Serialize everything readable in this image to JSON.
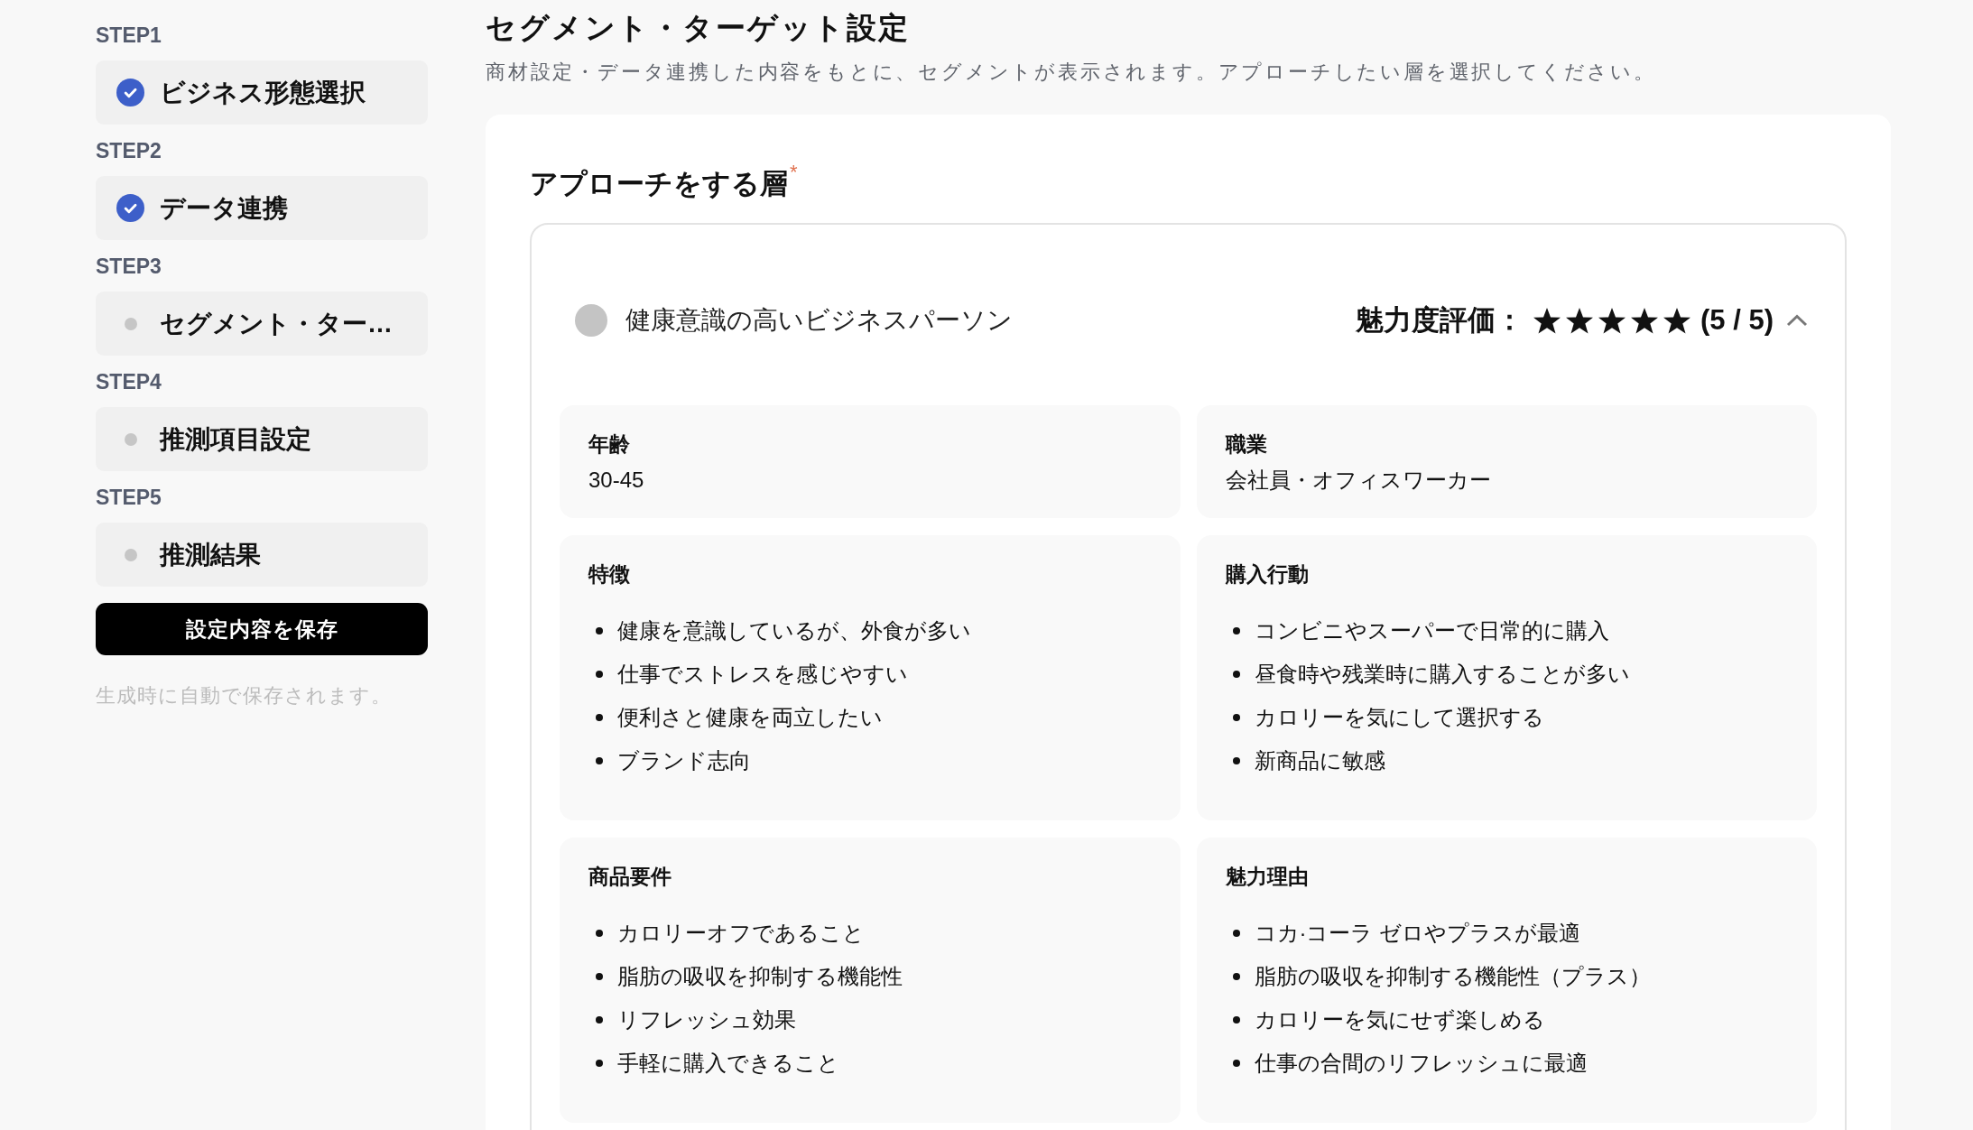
{
  "sidebar": {
    "steps": [
      {
        "step": "STEP1",
        "label": "ビジネス形態選択",
        "done": true
      },
      {
        "step": "STEP2",
        "label": "データ連携",
        "done": true
      },
      {
        "step": "STEP3",
        "label": "セグメント・ター…",
        "done": false
      },
      {
        "step": "STEP4",
        "label": "推測項目設定",
        "done": false
      },
      {
        "step": "STEP5",
        "label": "推測結果",
        "done": false
      }
    ],
    "save_button": "設定内容を保存",
    "note": "生成時に自動で保存されます。"
  },
  "header": {
    "title": "セグメント・ターゲット設定",
    "description": "商材設定・データ連携した内容をもとに、セグメントが表示されます。アプローチしたい層を選択してください。"
  },
  "form": {
    "field_label": "アプローチをする層",
    "required_mark": "*",
    "segments": [
      {
        "name": "健康意識の高いビジネスパーソン",
        "selected": false,
        "expanded": true,
        "rating_label": "魅力度評価：",
        "stars": 5,
        "rating_text": "(5 / 5)",
        "attributes": [
          {
            "kind": "value",
            "title": "年齢",
            "value": "30-45"
          },
          {
            "kind": "value",
            "title": "職業",
            "value": "会社員・オフィスワーカー"
          },
          {
            "kind": "list",
            "title": "特徴",
            "items": [
              "健康を意識しているが、外食が多い",
              "仕事でストレスを感じやすい",
              "便利さと健康を両立したい",
              "ブランド志向"
            ]
          },
          {
            "kind": "list",
            "title": "購入行動",
            "items": [
              "コンビニやスーパーで日常的に購入",
              "昼食時や残業時に購入することが多い",
              "カロリーを気にして選択する",
              "新商品に敏感"
            ]
          },
          {
            "kind": "list",
            "title": "商品要件",
            "items": [
              "カロリーオフであること",
              "脂肪の吸収を抑制する機能性",
              "リフレッシュ効果",
              "手軽に購入できること"
            ]
          },
          {
            "kind": "list",
            "title": "魅力理由",
            "items": [
              "コカ·コーラ ゼロやプラスが最適",
              "脂肪の吸収を抑制する機能性（プラス）",
              "カロリーを気にせず楽しめる",
              "仕事の合間のリフレッシュに最適"
            ]
          }
        ]
      }
    ]
  }
}
